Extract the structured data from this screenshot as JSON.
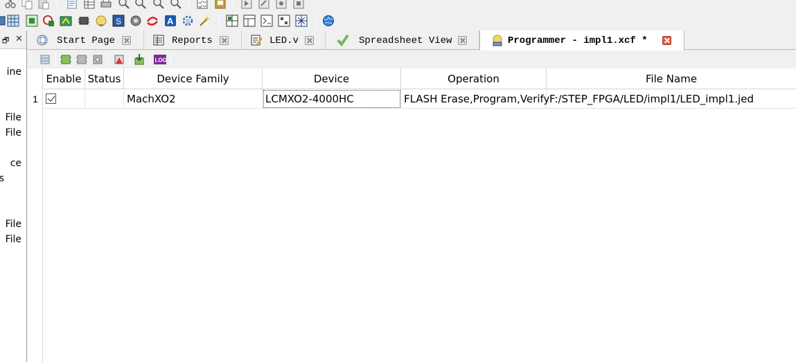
{
  "sidebar": {
    "texts": [
      "ine",
      "File",
      "File",
      "ce",
      "s",
      "File",
      "File"
    ]
  },
  "tabs": [
    {
      "label": "Start Page",
      "icon": "start-page-icon"
    },
    {
      "label": "Reports",
      "icon": "reports-icon"
    },
    {
      "label": "LED.v",
      "icon": "verilog-file-icon"
    },
    {
      "label": "Spreadsheet View",
      "icon": "spreadsheet-icon"
    },
    {
      "label": "Programmer - impl1.xcf *",
      "icon": "programmer-icon",
      "active": true
    }
  ],
  "grid": {
    "columns": [
      "Enable",
      "Status",
      "Device Family",
      "Device",
      "Operation",
      "File Name"
    ],
    "rows": [
      {
        "index": "1",
        "enabled": true,
        "status": "",
        "device_family": "MachXO2",
        "device": "LCMXO2-4000HC",
        "operation": "FLASH Erase,Program,Verify",
        "file_name": "F:/STEP_FPGA/LED/impl1/LED_impl1.jed"
      }
    ]
  },
  "toolbar_icons": [
    "cut-icon",
    "copy-icon",
    "paste-icon",
    "page-icon",
    "table-icon",
    "print-icon",
    "zoom-in-icon",
    "zoom-out-icon",
    "zoom-fit-icon",
    "zoom-area-icon",
    "checklist-icon",
    "export-icon",
    "run-icon",
    "step-icon",
    "run-to-icon",
    "stop-icon",
    "chip-icon",
    "grid-icon",
    "globe-chip-icon",
    "folder-icon",
    "block-icon",
    "bulb-icon",
    "netlist-icon",
    "search-chip-icon",
    "swap-icon",
    "a-icon",
    "gear-chip-icon",
    "wand-icon",
    "floorplan-icon",
    "layout-icon",
    "timing-icon",
    "route-icon",
    "web-icon"
  ],
  "programmer_toolbar_icons": [
    "scan-icon",
    "chip-program-icon",
    "chip-erase-icon",
    "chip-settings-icon",
    "chip-error-icon",
    "download-icon",
    "log-icon"
  ],
  "colors": {
    "active_tab_close": "#e25b4d",
    "window_bg": "#f0f0f0"
  }
}
